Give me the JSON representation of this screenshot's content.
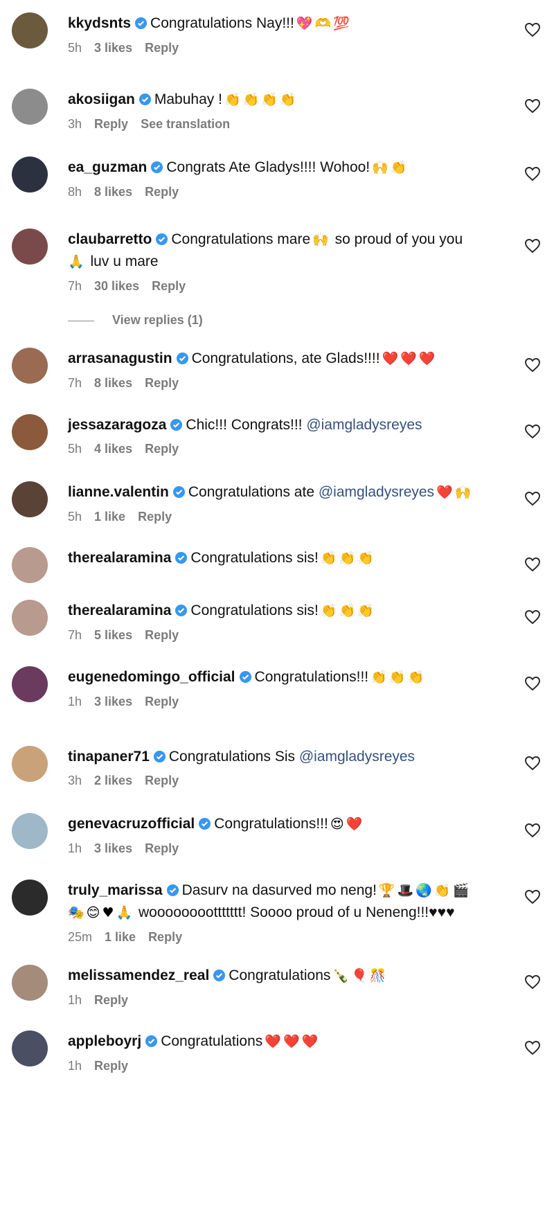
{
  "comments": [
    {
      "username": "kkydsnts",
      "verified": true,
      "text": "Congratulations Nay!!!",
      "emojis": "💖🫶💯",
      "time": "5h",
      "likes": "3 likes",
      "reply": "Reply",
      "avatar_color": "#6b5a3e"
    },
    {
      "username": "akosiigan",
      "verified": true,
      "text": "Mabuhay !",
      "emojis": "👏👏👏👏",
      "time": "3h",
      "reply": "Reply",
      "see_translation": "See translation",
      "avatar_color": "#8c8c8c"
    },
    {
      "username": "ea_guzman",
      "verified": true,
      "text": "Congrats Ate Gladys!!!! Wohoo!",
      "emojis": "🙌👏",
      "time": "8h",
      "likes": "8 likes",
      "reply": "Reply",
      "avatar_color": "#2c3140"
    },
    {
      "username": "claubarretto",
      "verified": true,
      "text": "Congratulations mare",
      "emojis": "🙌",
      "text2": "so proud of you you",
      "line2_emoji": "🙏",
      "line2_text": "luv u mare",
      "time": "7h",
      "likes": "30 likes",
      "reply": "Reply",
      "avatar_color": "#7a4a4a"
    },
    {
      "username": "arrasanagustin",
      "verified": true,
      "text": "Congratulations, ate Glads!!!!",
      "emojis": "❤️❤️❤️",
      "time": "7h",
      "likes": "8 likes",
      "reply": "Reply",
      "avatar_color": "#9a6b52"
    },
    {
      "username": "jessazaragoza",
      "verified": true,
      "text": "Chic!!! Congrats!!!",
      "mention": "@iamgladysreyes",
      "time": "5h",
      "likes": "4 likes",
      "reply": "Reply",
      "avatar_color": "#8b5a3c"
    },
    {
      "username": "lianne.valentin",
      "verified": true,
      "text": "Congratulations ate",
      "mention": "@iamgladysreyes",
      "emojis": "❤️🙌",
      "time": "5h",
      "likes": "1 like",
      "reply": "Reply",
      "avatar_color": "#5b4236"
    },
    {
      "username": "therealaramina",
      "verified": true,
      "text": "Congratulations sis!",
      "emojis": "👏👏👏",
      "avatar_color": "#b89a8e"
    },
    {
      "username": "therealaramina",
      "verified": true,
      "text": "Congratulations sis!",
      "emojis": "👏👏👏",
      "time": "7h",
      "likes": "5 likes",
      "reply": "Reply",
      "avatar_color": "#b89a8e"
    },
    {
      "username": "eugenedomingo_official",
      "verified": true,
      "text": "Congratulations!!!",
      "emojis": "👏👏👏",
      "time": "1h",
      "likes": "3 likes",
      "reply": "Reply",
      "avatar_color": "#6a3b5e"
    },
    {
      "username": "tinapaner71",
      "verified": true,
      "text": "Congratulations Sis",
      "mention": "@iamgladysreyes",
      "time": "3h",
      "likes": "2 likes",
      "reply": "Reply",
      "avatar_color": "#c9a27a"
    },
    {
      "username": "genevacruzofficial",
      "verified": true,
      "text": "Congratulations!!!",
      "emojis": "😍❤️",
      "time": "1h",
      "likes": "3 likes",
      "reply": "Reply",
      "avatar_color": "#9fb8c8"
    },
    {
      "username": "truly_marissa",
      "verified": true,
      "text": "Dasurv na dasurved mo neng!",
      "emojis": "🏆🎩🌏👏🎬",
      "line2_emoji": "🎭😊♥🙏",
      "line2_text": "woooooooottttttt! Soooo proud of u Neneng!!!♥♥♥",
      "time": "25m",
      "likes": "1 like",
      "reply": "Reply",
      "avatar_color": "#2b2b2b"
    },
    {
      "username": "melissamendez_real",
      "verified": true,
      "text": "Congratulations",
      "emojis": "🍾🎈🎊",
      "time": "1h",
      "reply": "Reply",
      "avatar_color": "#a58b7a"
    },
    {
      "username": "appleboyrj",
      "verified": true,
      "text": "Congratulations",
      "emojis": "❤️❤️❤️",
      "time": "1h",
      "reply": "Reply",
      "avatar_color": "#4a4f63"
    }
  ],
  "view_replies": "View replies (1)",
  "colors": {
    "accent_blue": "#3897f0",
    "mention": "#36507d",
    "meta_gray": "#7b7b7b"
  }
}
